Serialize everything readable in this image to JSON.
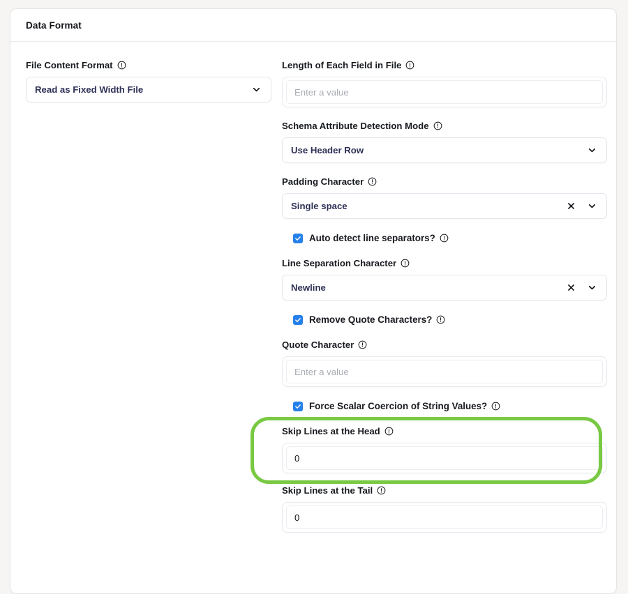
{
  "card": {
    "title": "Data Format"
  },
  "icons": {
    "info": "alert-circle-icon",
    "clear": "close-x-icon",
    "chevron": "chevron-down-icon",
    "check": "checkmark-icon"
  },
  "colors": {
    "accent_checkbox": "#2680eb",
    "annotation_green": "#79c943",
    "select_value_text": "#2e3156",
    "label_text": "#171a1f",
    "placeholder_text": "#a9adb4",
    "page_background": "#f6f5f3",
    "card_background": "#ffffff"
  },
  "left_column": {
    "file_content_format": {
      "label": "File Content Format",
      "value": "Read as Fixed Width File",
      "type": "select"
    }
  },
  "right_column": {
    "length_of_each_field": {
      "label": "Length of Each Field in File",
      "value": "",
      "placeholder": "Enter a value",
      "type": "input"
    },
    "schema_attribute_detection_mode": {
      "label": "Schema Attribute Detection Mode",
      "value": "Use Header Row",
      "type": "select"
    },
    "padding_character": {
      "label": "Padding Character",
      "value": "Single space",
      "type": "select-clearable"
    },
    "auto_detect_line_separators": {
      "label": "Auto detect line separators?",
      "checked": true,
      "type": "checkbox"
    },
    "line_separation_character": {
      "label": "Line Separation Character",
      "value": "Newline",
      "type": "select-clearable"
    },
    "remove_quote_characters": {
      "label": "Remove Quote Characters?",
      "checked": true,
      "type": "checkbox"
    },
    "quote_character": {
      "label": "Quote Character",
      "value": "",
      "placeholder": "Enter a value",
      "type": "input"
    },
    "force_scalar_coercion": {
      "label": "Force Scalar Coercion of String Values?",
      "checked": true,
      "type": "checkbox"
    },
    "skip_lines_at_head": {
      "label": "Skip Lines at the Head",
      "value": "0",
      "type": "input",
      "highlighted": true
    },
    "skip_lines_at_tail": {
      "label": "Skip Lines at the Tail",
      "value": "0",
      "type": "input"
    }
  }
}
